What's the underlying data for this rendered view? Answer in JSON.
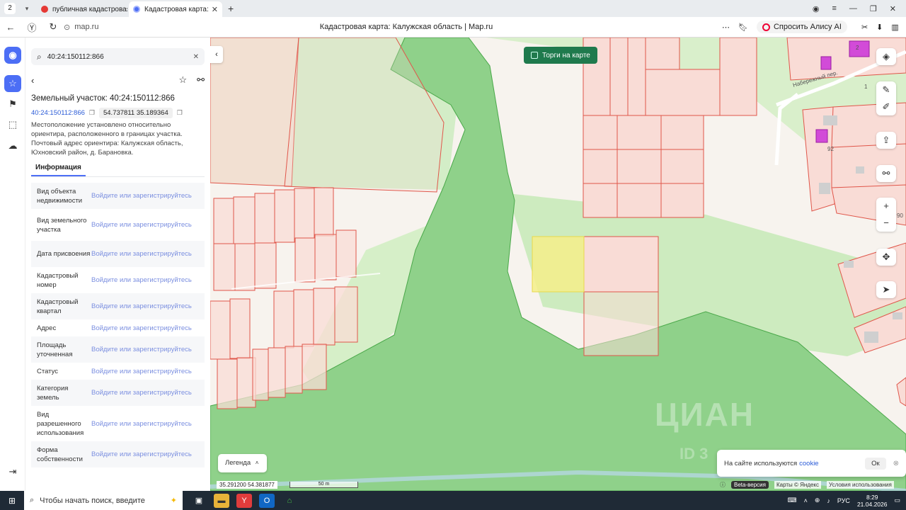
{
  "browser": {
    "tab_counter": "2",
    "tabs": [
      {
        "title": "публичная кадастровая карта"
      },
      {
        "title": "Кадастровая карта: Калужская область | Map.ru"
      }
    ],
    "address": "map.ru",
    "page_title": "Кадастровая карта: Калужская область | Map.ru",
    "alice_button": "Спросить Алису AI"
  },
  "panel": {
    "search_value": "40:24:150112:866",
    "object_title": "Земельный участок: 40:24:150112:866",
    "cadastral_link": "40:24:150112:866",
    "coords_chip": "54.737811 35.189364",
    "description": "Местоположение установлено относительно ориентира, расположенного в границах участка. Почтовый адрес ориентира: Калужская область, Юхновский район, д. Барановка.",
    "info_tab": "Информация",
    "login_text": "Войдите или зарегистрируйтесь",
    "rows": [
      {
        "label": "Вид объекта недвижимости"
      },
      {
        "label": "Вид земельного участка"
      },
      {
        "label": "Дата присвоения"
      },
      {
        "label": "Кадастровый номер"
      },
      {
        "label": "Кадастровый квартал"
      },
      {
        "label": "Адрес"
      },
      {
        "label": "Площадь уточненная"
      },
      {
        "label": "Статус"
      },
      {
        "label": "Категория земель"
      },
      {
        "label": "Вид разрешенного использования"
      },
      {
        "label": "Форма собственности"
      }
    ]
  },
  "map": {
    "torgi_label": "Торги на карте",
    "legend_label": "Легенда",
    "coords_readout": "35.291200   54.381877",
    "scale_label": "50 m",
    "cookie_text": "На сайте используются",
    "cookie_link": "cookie",
    "cookie_ok": "Ок",
    "beta_label": "Beta-версия",
    "attribution": "Карты © Яндекс",
    "terms": "Условия использования",
    "street_name": "Набережный пер.",
    "house_numbers": [
      "2",
      "1",
      "92",
      "90"
    ],
    "watermark": "ЦИАН",
    "watermark_id": "ID 3",
    "colors": {
      "forest": "#8fd18a",
      "meadow": "#cdebbf",
      "parcel_fill": "#f9dcd6",
      "parcel_stroke": "#e0564a",
      "selected": "#f5ee8a",
      "building": "#d24bd8"
    }
  },
  "taskbar": {
    "search_placeholder": "Чтобы начать поиск, введите",
    "lang": "РУС",
    "time": "8:29",
    "date": "21.04.2026"
  }
}
